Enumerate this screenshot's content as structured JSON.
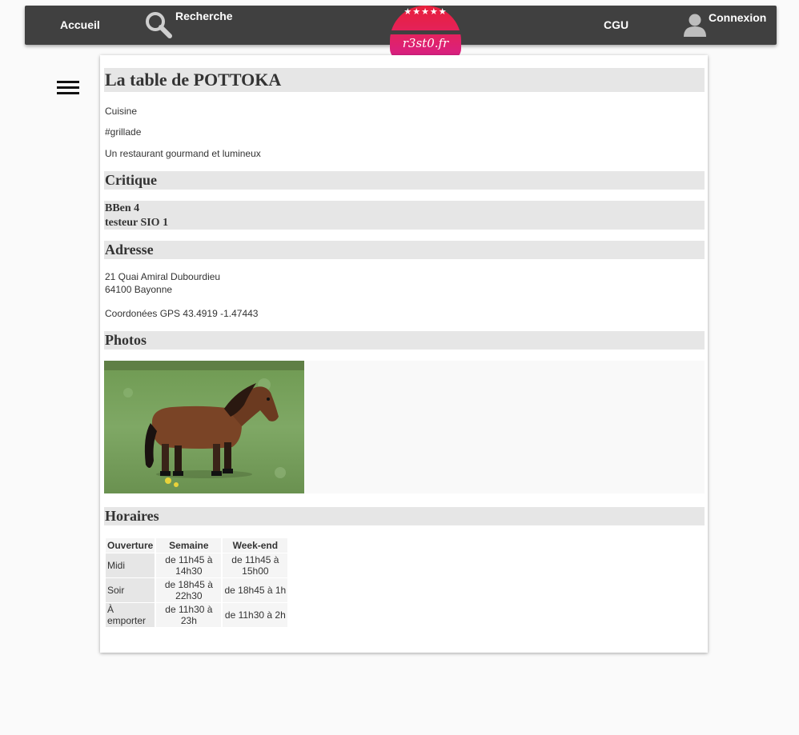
{
  "nav": {
    "home_label": "Accueil",
    "search_label": "Recherche",
    "cgu_label": "CGU",
    "login_label": "Connexion",
    "logo_stars": "★★★★★",
    "logo_text": "r3st0.fr"
  },
  "restaurant": {
    "title": "La table de POTTOKA",
    "category": "Cuisine",
    "tag": "#grillade",
    "description": "Un restaurant gourmand et lumineux"
  },
  "critique": {
    "heading": "Critique",
    "entries": [
      "BBen 4",
      "testeur SIO 1"
    ]
  },
  "adresse": {
    "heading": "Adresse",
    "street": "21 Quai Amiral Dubourdieu",
    "city": "64100 Bayonne",
    "gps": "Coordonées GPS 43.4919 -1.47443"
  },
  "photos": {
    "heading": "Photos"
  },
  "horaires": {
    "heading": "Horaires",
    "columns": [
      "Ouverture",
      "Semaine",
      "Week-end"
    ],
    "rows": [
      {
        "label": "Midi",
        "semaine": "de 11h45 à 14h30",
        "weekend": "de 11h45 à 15h00"
      },
      {
        "label": "Soir",
        "semaine": "de 18h45 à 22h30",
        "weekend": "de 18h45 à 1h"
      },
      {
        "label": "À emporter",
        "semaine": "de 11h30 à 23h",
        "weekend": "de 11h30 à 2h"
      }
    ]
  },
  "colors": {
    "nav_bg": "#404040",
    "logo_gradient_top": "#e8203a",
    "logo_gradient_bottom": "#d6208a",
    "section_bg": "#e6e6e6",
    "page_bg": "#fafafa"
  }
}
